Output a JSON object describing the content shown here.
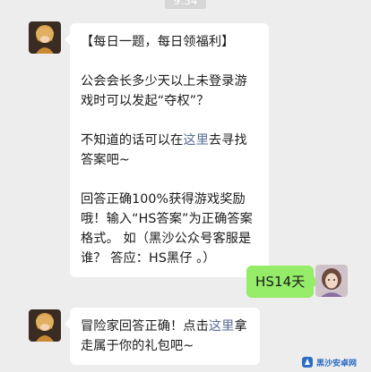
{
  "status": {
    "time": "9:34"
  },
  "messages": [
    {
      "side": "left",
      "lines": {
        "title": "【每日一题，每日领福利】",
        "question": "公会会长多少天以上未登录游戏时可以发起“夺权”？",
        "hint_before": "不知道的话可以在",
        "hint_link": "这里",
        "hint_after": "去寻找答案吧~",
        "reward": "回答正确100%获得游戏奖励哦！输入“HS答案”为正确答案格式。 如（黑沙公众号客服是谁？ 答应：HS黑仔 。）"
      }
    },
    {
      "side": "right",
      "text": "HS14天"
    },
    {
      "side": "left",
      "lines": {
        "before": "冒险家回答正确！点击",
        "link": "这里",
        "after": "拿走属于你的礼包吧~"
      }
    }
  ],
  "watermark": {
    "text": "黑沙安卓网"
  },
  "colors": {
    "background": "#ededed",
    "bubble_left": "#ffffff",
    "bubble_right": "#95ec69",
    "link": "#576b95"
  }
}
